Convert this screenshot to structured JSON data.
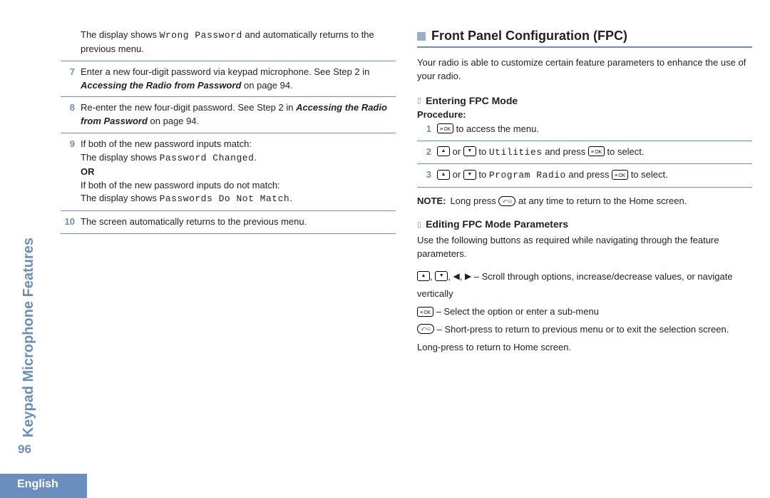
{
  "sidebar": {
    "title": "Keypad Microphone Features"
  },
  "page_number": "96",
  "language": "English",
  "left": {
    "intro_pre": "The display shows ",
    "intro_mono": "Wrong Password",
    "intro_post": " and automatically returns to the previous menu.",
    "steps": {
      "s7": {
        "num": "7",
        "t1": "Enter a new four-digit password via keypad microphone. See Step 2 in ",
        "bi": "Accessing the Radio from Password",
        "t2": " on page 94."
      },
      "s8": {
        "num": "8",
        "t1": "Re-enter the new four-digit password. See Step 2 in ",
        "bi": "Accessing the Radio from Password",
        "t2": " on page 94."
      },
      "s9": {
        "num": "9",
        "l1": "If both of the new password inputs match:",
        "l2a": "The display shows ",
        "l2mono": "Password Changed",
        "l2b": ".",
        "or": "OR",
        "l3": "If both of the new password inputs do not match:",
        "l4a": "The display shows ",
        "l4mono": "Passwords Do Not Match",
        "l4b": "."
      },
      "s10": {
        "num": "10",
        "t": "The screen automatically returns to the previous menu."
      }
    }
  },
  "right": {
    "heading": "Front Panel Configuration (FPC)",
    "intro": "Your radio is able to customize certain feature parameters to enhance the use of your radio.",
    "sub1": "Entering FPC Mode",
    "procedure": "Procedure:",
    "steps": {
      "s1": {
        "num": "1",
        "t_post": " to access the menu."
      },
      "s2": {
        "num": "2",
        "mid": " or ",
        "to": " to ",
        "mono": "Utilities",
        "and": " and press ",
        "end": " to select."
      },
      "s3": {
        "num": "3",
        "mid": " or ",
        "to": " to ",
        "mono": "Program Radio",
        "and": " and press ",
        "end": " to select."
      }
    },
    "note_label": "NOTE:",
    "note_pre": "Long press ",
    "note_post": " at any time to return to the Home screen.",
    "sub2": "Editing FPC Mode Parameters",
    "edit_intro": "Use the following buttons as required while navigating through the feature parameters.",
    "rows": {
      "r1": " – Scroll through options, increase/decrease values, or navigate vertically",
      "r2": " – Select the option or enter a sub-menu",
      "r3": " – Short-press to return to previous menu or to exit the selection screen. Long-press to return to Home screen."
    },
    "sep": ", "
  }
}
